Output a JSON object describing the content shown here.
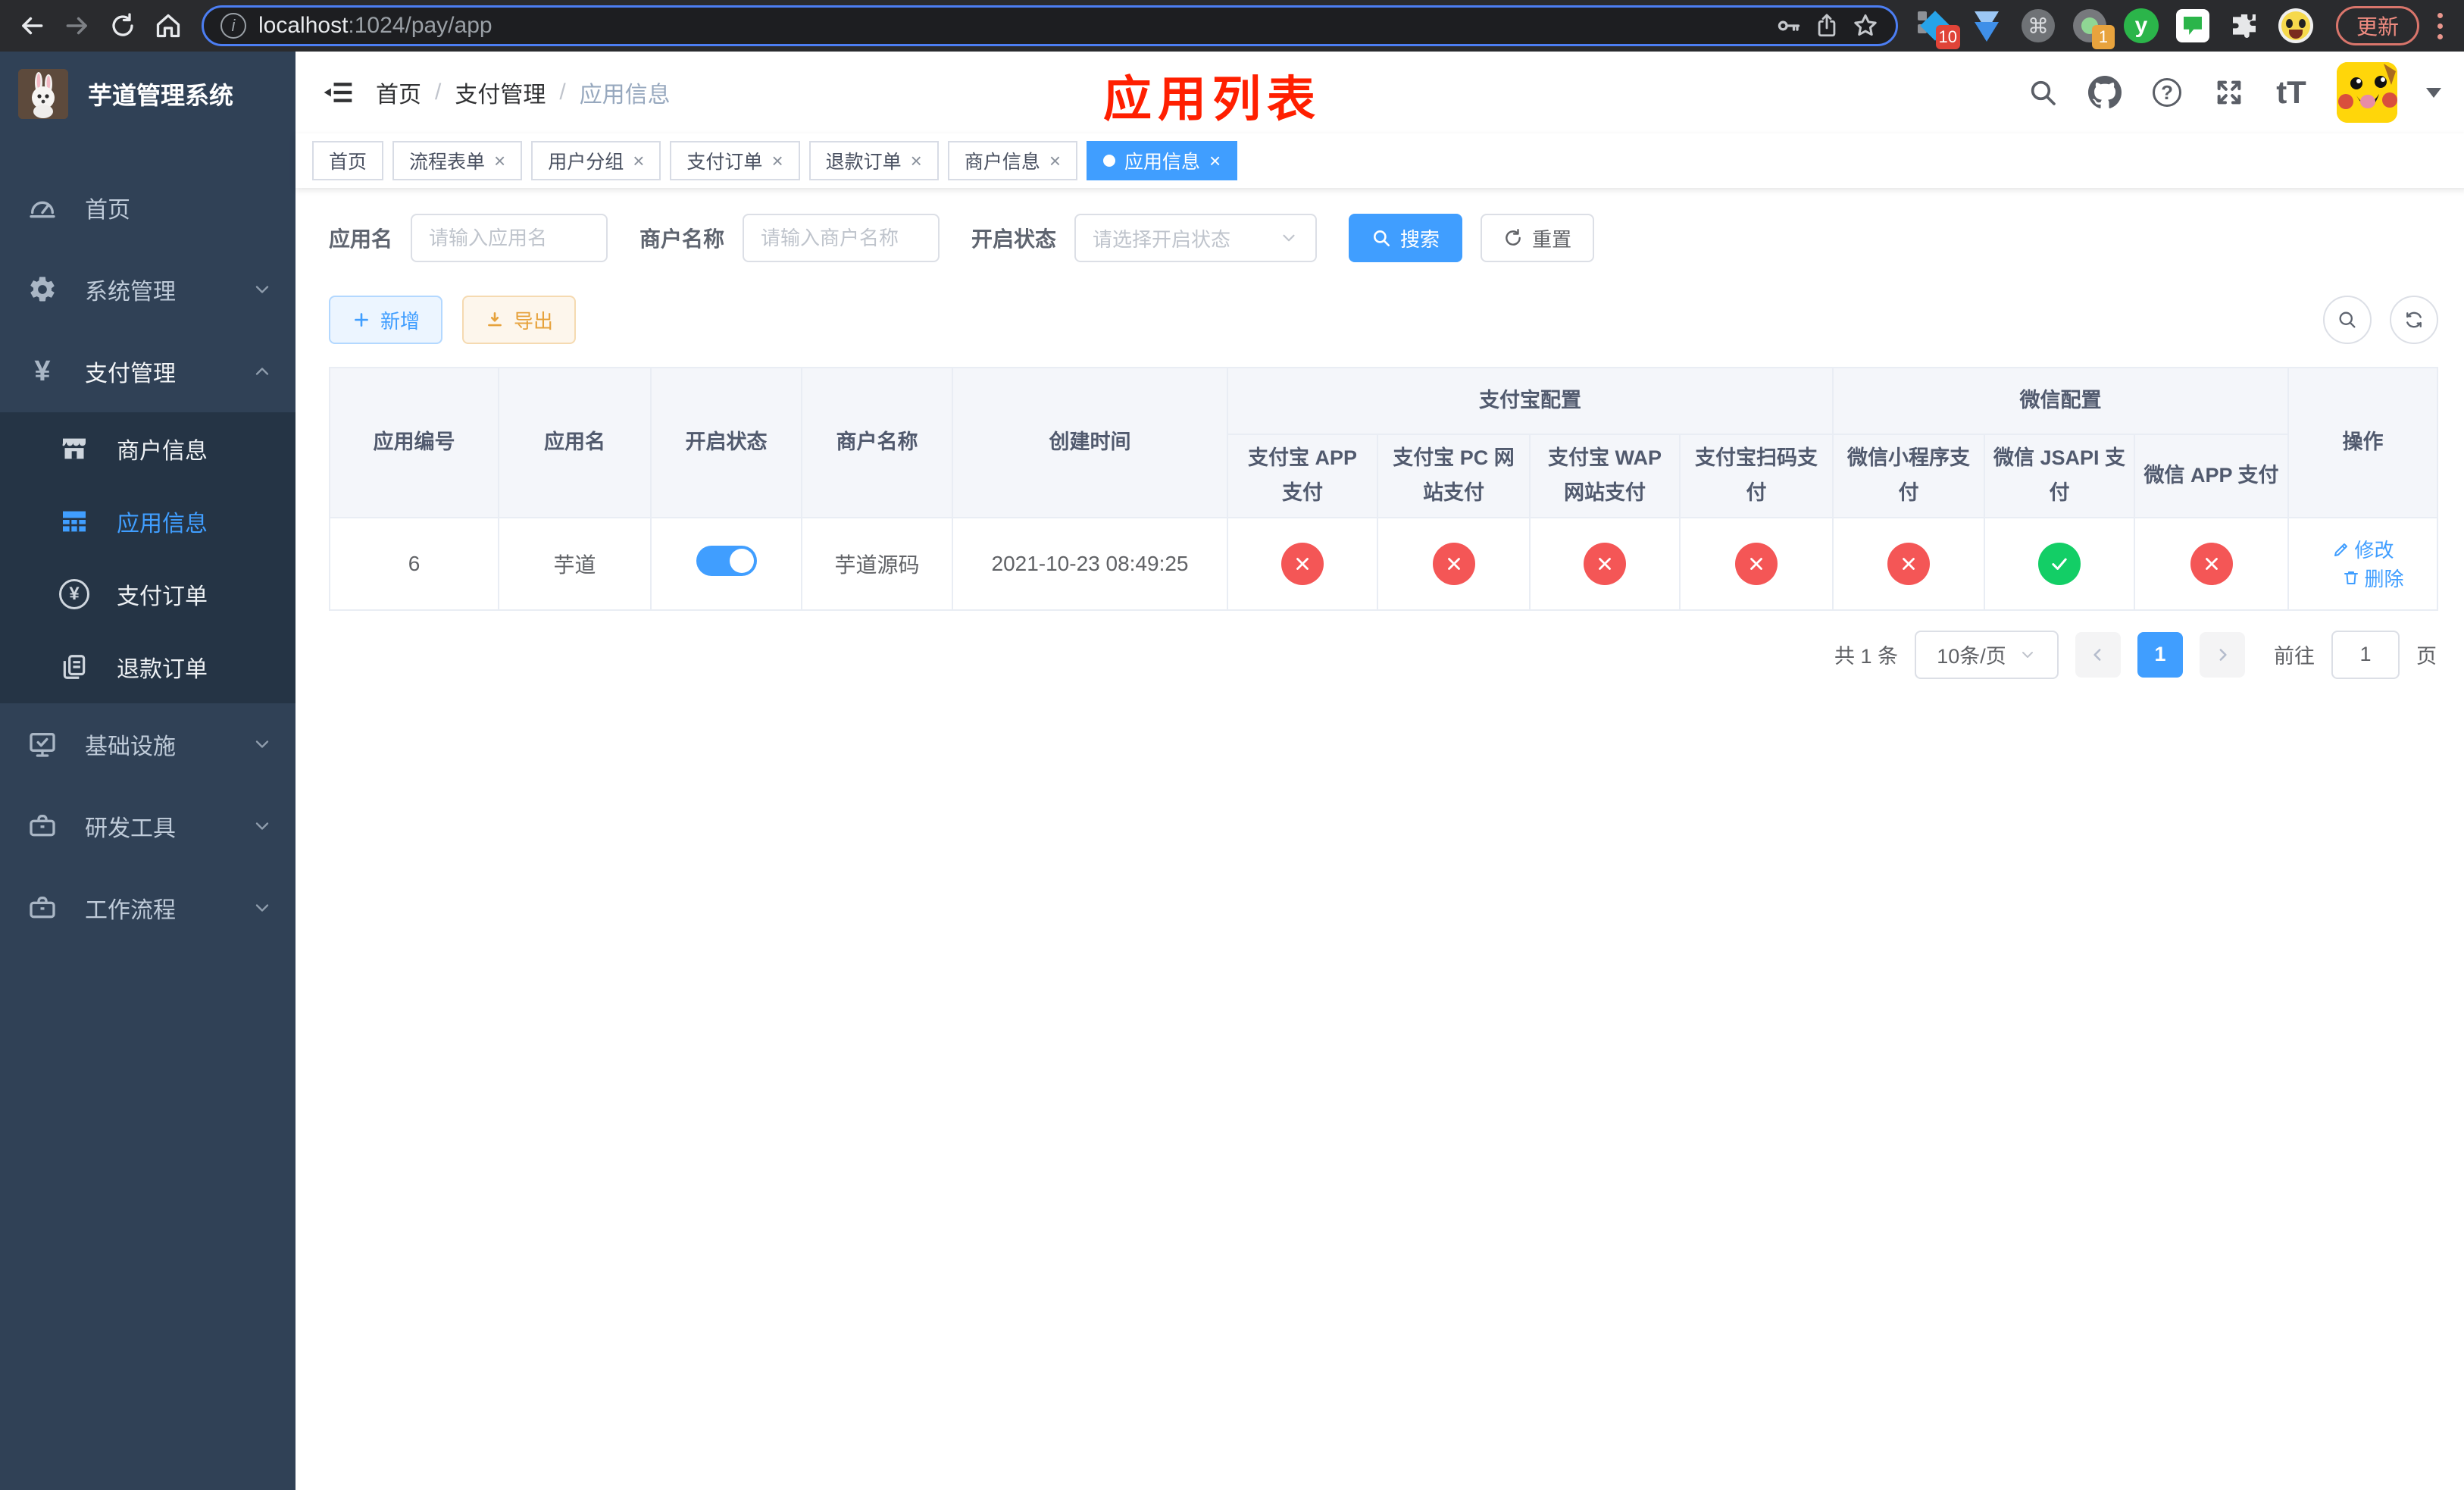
{
  "browser": {
    "url_host": "localhost",
    "url_rest": ":1024/pay/app",
    "update_label": "更新",
    "ext_badge_blocks": "10",
    "ext_badge_record": "1",
    "ext_y_letter": "y",
    "ext_cmd_glyph": "⌘"
  },
  "icons": {
    "close": "×",
    "yen": "¥",
    "info": "i",
    "question": "?",
    "font_size": "tT"
  },
  "sidebar": {
    "title": "芋道管理系统",
    "items": [
      {
        "label": "首页"
      },
      {
        "label": "系统管理"
      },
      {
        "label": "支付管理"
      },
      {
        "label": "商户信息"
      },
      {
        "label": "应用信息"
      },
      {
        "label": "支付订单"
      },
      {
        "label": "退款订单"
      },
      {
        "label": "基础设施"
      },
      {
        "label": "研发工具"
      },
      {
        "label": "工作流程"
      }
    ]
  },
  "header": {
    "breadcrumb": [
      "首页",
      "支付管理",
      "应用信息"
    ],
    "annotation": "应用列表"
  },
  "tabs": [
    {
      "label": "首页"
    },
    {
      "label": "流程表单"
    },
    {
      "label": "用户分组"
    },
    {
      "label": "支付订单"
    },
    {
      "label": "退款订单"
    },
    {
      "label": "商户信息"
    },
    {
      "label": "应用信息"
    }
  ],
  "filters": {
    "app_name_label": "应用名",
    "app_name_placeholder": "请输入应用名",
    "merchant_label": "商户名称",
    "merchant_placeholder": "请输入商户名称",
    "status_label": "开启状态",
    "status_placeholder": "请选择开启状态",
    "search_label": "搜索",
    "reset_label": "重置"
  },
  "toolbar": {
    "add_label": "新增",
    "export_label": "导出"
  },
  "table": {
    "columns": [
      "应用编号",
      "应用名",
      "开启状态",
      "商户名称",
      "创建时间"
    ],
    "group_alipay": "支付宝配置",
    "group_wechat": "微信配置",
    "alipay_columns": [
      "支付宝 APP 支付",
      "支付宝 PC 网站支付",
      "支付宝 WAP 网站支付",
      "支付宝扫码支付"
    ],
    "wechat_columns": [
      "微信小程序支付",
      "微信 JSAPI 支付",
      "微信 APP 支付"
    ],
    "op_column": "操作",
    "rows": [
      {
        "id": "6",
        "name": "芋道",
        "enabled": true,
        "merchant": "芋道源码",
        "created": "2021-10-23 08:49:25",
        "channels": [
          "cross",
          "cross",
          "cross",
          "cross",
          "cross",
          "check",
          "cross"
        ],
        "edit_label": "修改",
        "delete_label": "删除"
      }
    ]
  },
  "pagination": {
    "total": "共 1 条",
    "page_size": "10条/页",
    "current_page": "1",
    "goto_label": "前往",
    "goto_value": "1",
    "page_unit": "页"
  }
}
